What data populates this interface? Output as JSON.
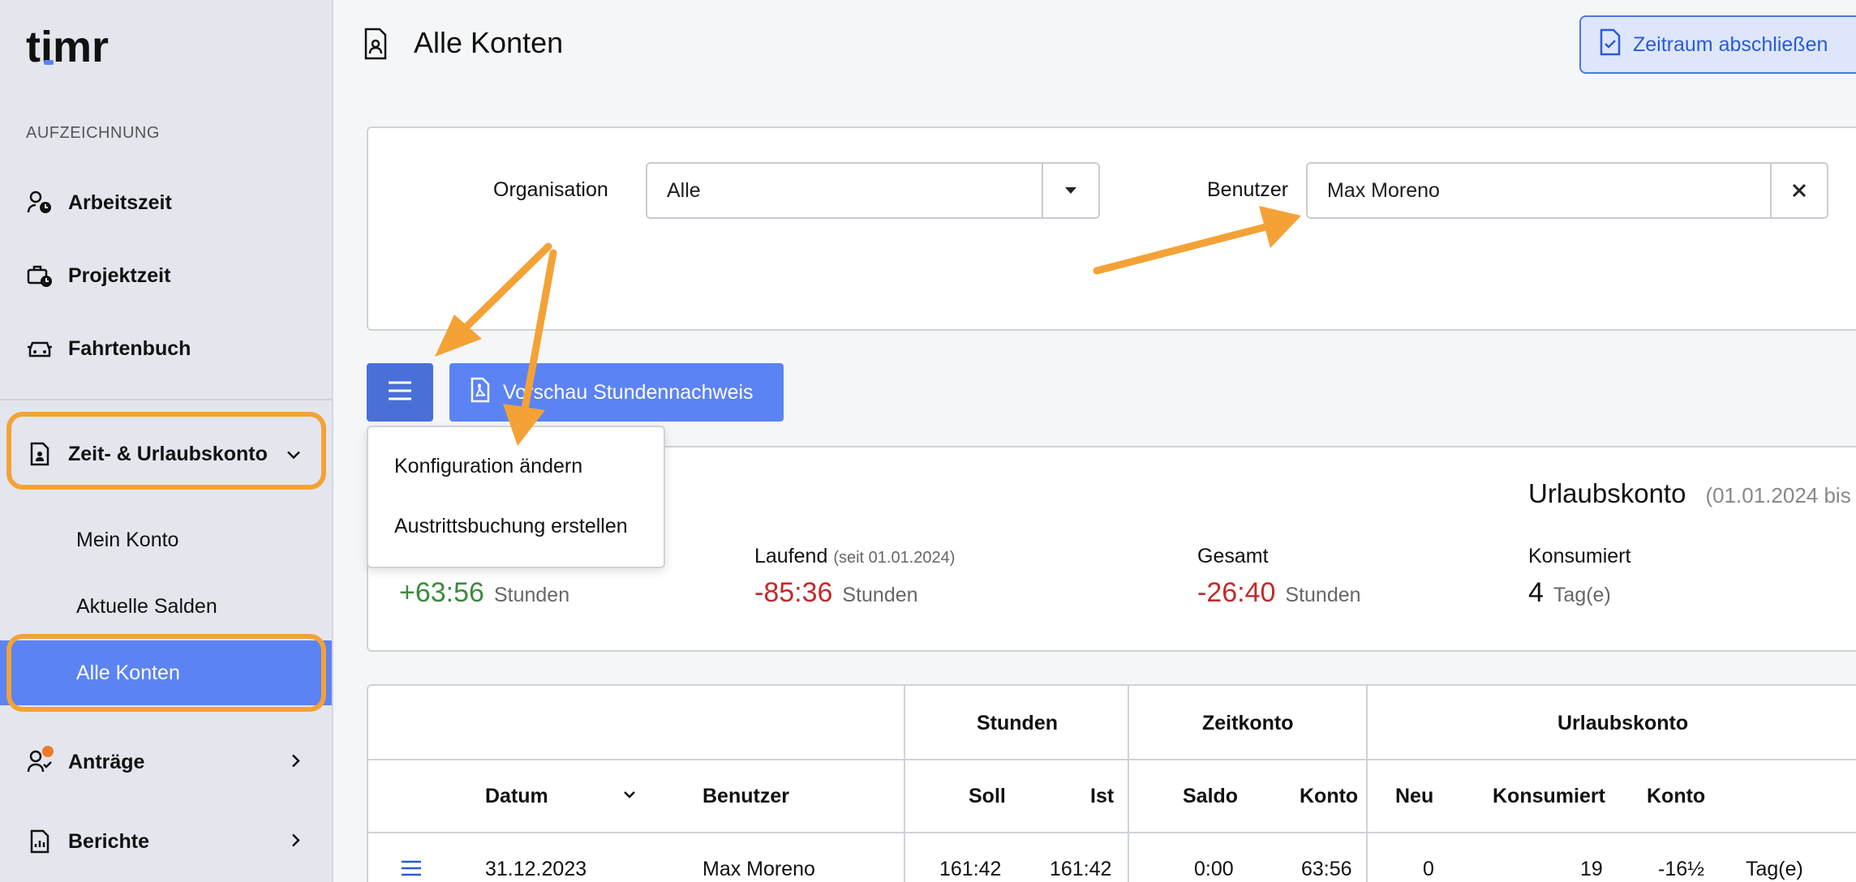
{
  "app": {
    "logo": "timr"
  },
  "sidebar": {
    "section_label": "AUFZEICHNUNG",
    "items": [
      {
        "label": "Arbeitszeit",
        "icon": "user-clock-icon"
      },
      {
        "label": "Projektzeit",
        "icon": "briefcase-clock-icon"
      },
      {
        "label": "Fahrtenbuch",
        "icon": "car-icon"
      },
      {
        "label": "Zeit- & Urlaubskonto",
        "icon": "account-badge-icon"
      },
      {
        "label": "Anträge",
        "icon": "user-check-icon"
      },
      {
        "label": "Berichte",
        "icon": "report-icon"
      }
    ],
    "sub_items": [
      {
        "label": "Mein Konto"
      },
      {
        "label": "Aktuelle Salden"
      },
      {
        "label": "Alle Konten"
      }
    ]
  },
  "header": {
    "title": "Alle Konten",
    "close_period_label": "Zeitraum abschließen"
  },
  "filters": {
    "organisation_label": "Organisation",
    "organisation_value": "Alle",
    "user_label": "Benutzer",
    "user_value": "Max Moreno"
  },
  "toolbar": {
    "preview_label": "Vorschau Stundennachweis"
  },
  "dropdown": {
    "items": [
      {
        "label": "Konfiguration ändern"
      },
      {
        "label": "Austrittsbuchung erstellen"
      }
    ]
  },
  "summary": {
    "start_value": "+63:56",
    "start_unit": "Stunden",
    "running_label": "Laufend",
    "running_since": "(seit 01.01.2024)",
    "running_value": "-85:36",
    "running_unit": "Stunden",
    "total_label": "Gesamt",
    "total_value": "-26:40",
    "total_unit": "Stunden",
    "vacation_title": "Urlaubskonto",
    "vacation_range": "(01.01.2024 bis",
    "consumed_label": "Konsumiert",
    "consumed_value": "4",
    "consumed_unit": "Tag(e)"
  },
  "table": {
    "group_headers": {
      "stunden": "Stunden",
      "zeitkonto": "Zeitkonto",
      "urlaubskonto": "Urlaubskonto"
    },
    "columns": {
      "datum": "Datum",
      "benutzer": "Benutzer",
      "soll": "Soll",
      "ist": "Ist",
      "saldo": "Saldo",
      "konto": "Konto",
      "neu": "Neu",
      "konsumiert": "Konsumiert",
      "urlaub_konto": "Konto"
    },
    "rows": [
      {
        "datum": "31.12.2023",
        "benutzer": "Max Moreno",
        "soll": "161:42",
        "ist": "161:42",
        "saldo": "0:00",
        "konto": "63:56",
        "neu": "0",
        "konsumiert": "19",
        "urlaub_konto": "-16½",
        "unit": "Tag(e)"
      }
    ]
  },
  "colors": {
    "accent": "#5b83f4",
    "highlight": "#f4a236",
    "positive": "#3c8b3c",
    "negative": "#c22b2b"
  }
}
